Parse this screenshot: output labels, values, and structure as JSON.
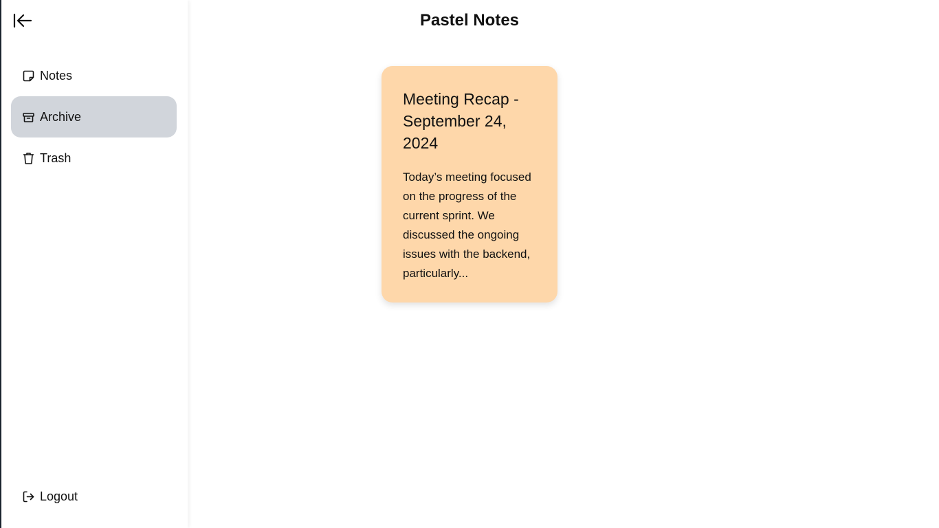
{
  "app": {
    "title": "Pastel Notes"
  },
  "sidebar": {
    "collapse_icon": "collapse-left-icon",
    "items": [
      {
        "label": "Notes",
        "icon": "note-icon",
        "active": false
      },
      {
        "label": "Archive",
        "icon": "archive-icon",
        "active": true
      },
      {
        "label": "Trash",
        "icon": "trash-icon",
        "active": false
      }
    ],
    "logout": {
      "label": "Logout",
      "icon": "logout-icon"
    }
  },
  "notes": [
    {
      "title": "Meeting Recap - September 24, 2024",
      "excerpt": "Today’s meeting focused on the progress of the current sprint. We discussed the ongoing issues with the backend, particularly...",
      "color": "#fed7aa"
    }
  ],
  "colors": {
    "active_nav": "#d1d5db",
    "window_edge": "#1c2530"
  }
}
